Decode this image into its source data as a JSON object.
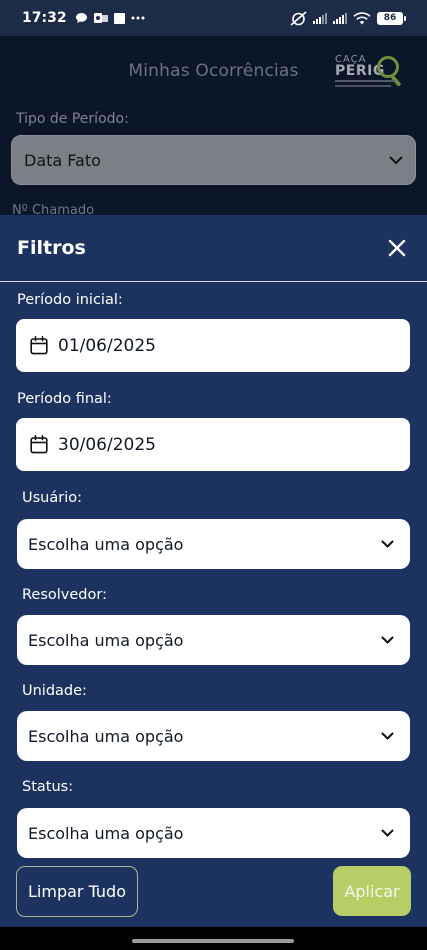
{
  "status_bar": {
    "time": "17:32",
    "left_icons": [
      "chat-bubble-icon",
      "outlook-icon",
      "square-icon",
      "more-dots-icon"
    ],
    "right_icons": [
      "alarm-off-icon",
      "signal-icon",
      "signal-icon",
      "wifi-icon",
      "battery-icon"
    ],
    "battery_level": "86"
  },
  "background_page": {
    "title": "Minhas Ocorrências",
    "logo": {
      "line1": "CAÇA",
      "line2": "PERIG"
    },
    "period_type_label": "Tipo de Período:",
    "period_type_value": "Data Fato",
    "next_label": "Nº Chamado"
  },
  "sheet": {
    "title": "Filtros",
    "fields": {
      "start_label": "Período inicial:",
      "start_value": "01/06/2025",
      "end_label": "Período final:",
      "end_value": "30/06/2025",
      "user_label": "Usuário:",
      "user_value": "Escolha uma opção",
      "resolver_label": "Resolvedor:",
      "resolver_value": "Escolha uma opção",
      "unit_label": "Unidade:",
      "unit_value": "Escolha uma opção",
      "status_label": "Status:",
      "status_value": "Escolha uma opção"
    },
    "buttons": {
      "clear": "Limpar Tudo",
      "apply": "Aplicar"
    }
  },
  "colors": {
    "sheet_bg": "#1c335f",
    "accent_green": "#b7cd66",
    "dim_bg": "#0c1629"
  }
}
